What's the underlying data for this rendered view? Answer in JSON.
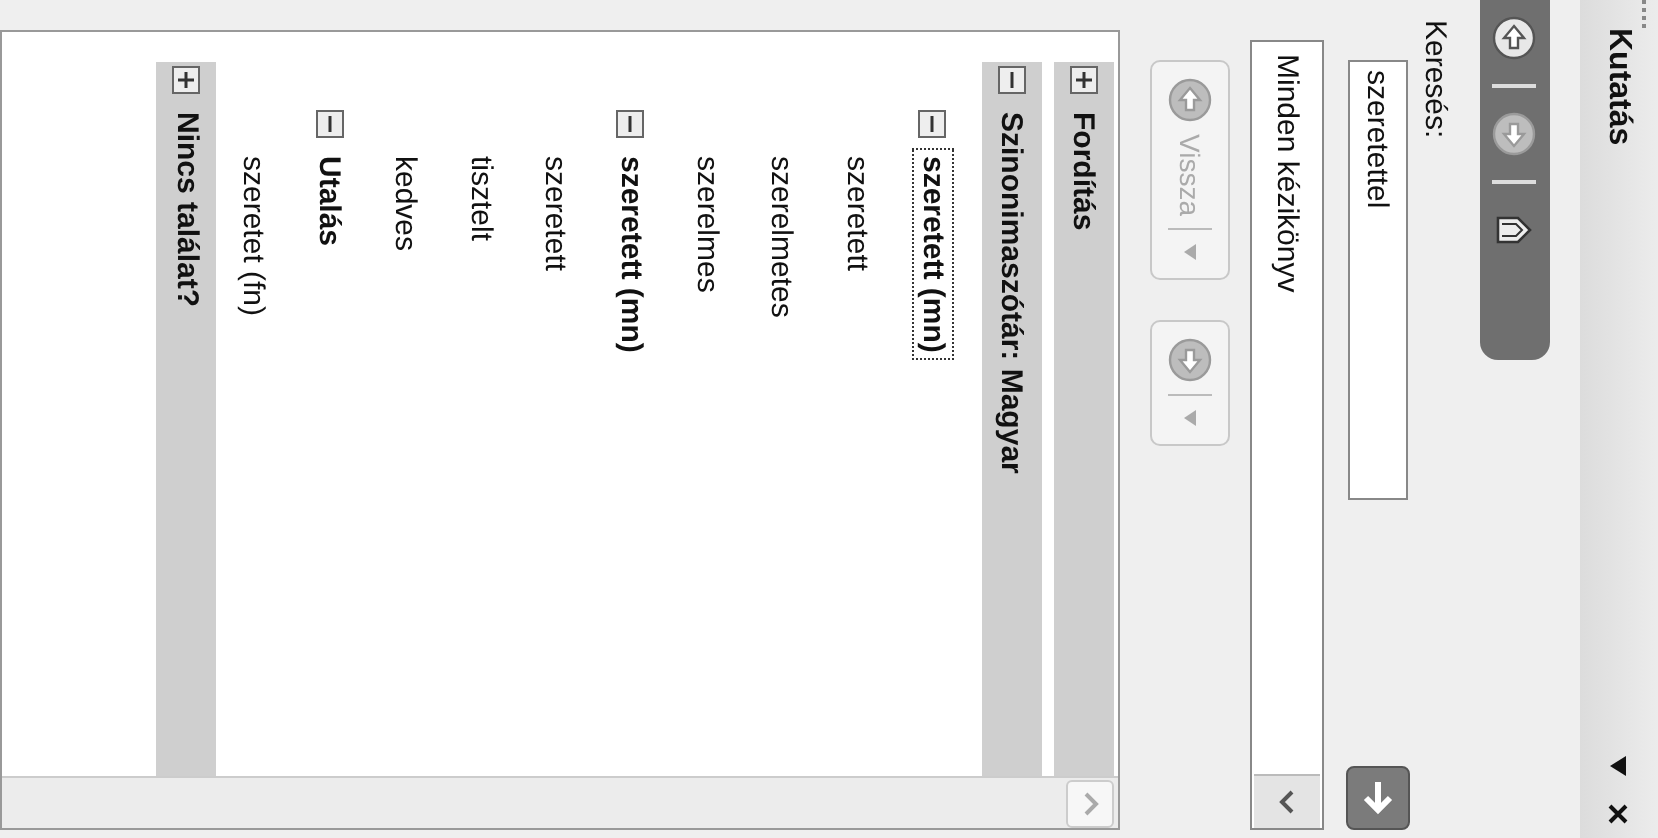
{
  "title": "Kutatás",
  "toolbar": [
    {
      "kind": "back",
      "disabled": false
    },
    {
      "kind": "forward",
      "disabled": true
    },
    {
      "kind": "book",
      "disabled": false
    }
  ],
  "search": {
    "label": "Keresés:",
    "value": "szeretettel"
  },
  "source": {
    "value": "Minden kézikönyv"
  },
  "nav_buttons": [
    {
      "kind": "back",
      "label": "Vissza",
      "disabled": true
    },
    {
      "kind": "forward",
      "disabled": true
    }
  ],
  "results": [
    {
      "label": "Fordítás",
      "expanded": false
    },
    {
      "label": "Szinonimaszótár: Magyar",
      "expanded": true,
      "children": [
        {
          "label": "szeretett (mn)",
          "expanded": true,
          "selected": true,
          "children": [
            {
              "label": "szeretett"
            },
            {
              "label": "szerelmetes"
            },
            {
              "label": "szerelmes"
            }
          ]
        },
        {
          "label": "szeretett (mn)",
          "expanded": true,
          "selected": false,
          "children": [
            {
              "label": "szeretett"
            },
            {
              "label": "tisztelt"
            },
            {
              "label": "kedves"
            }
          ]
        },
        {
          "label": "Utalás",
          "expanded": true,
          "selected": false,
          "children": [
            {
              "label": "szeretet (fn)"
            }
          ]
        }
      ]
    },
    {
      "label": "Nincs találat?",
      "expanded": false
    }
  ]
}
